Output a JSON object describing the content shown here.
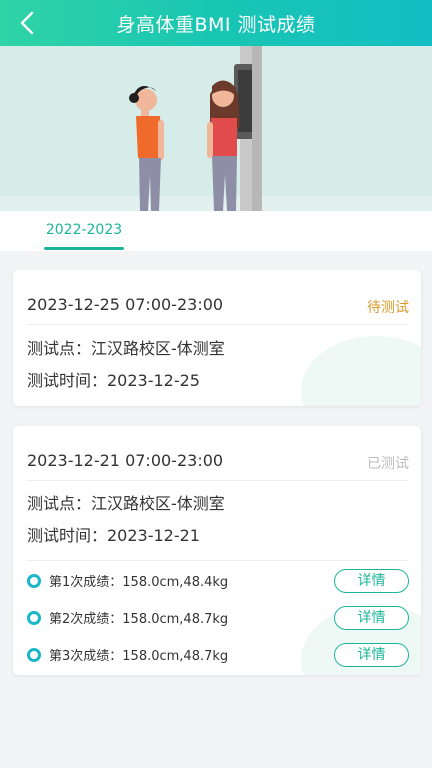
{
  "header": {
    "title": "身高体重BMI 测试成绩"
  },
  "tabs": [
    {
      "label": "2022-2023",
      "active": true
    }
  ],
  "colors": {
    "accent": "#1bb69a",
    "header_start": "#2fd3a6",
    "header_end": "#14bec3",
    "pending": "#d99b2b",
    "done": "#bdbdbd",
    "dot": "#1ab6c9"
  },
  "records": [
    {
      "time_range": "2023-12-25 07:00-23:00",
      "status": "待测试",
      "location": "测试点：江汉路校区-体测室",
      "test_date": "测试时间：2023-12-25"
    },
    {
      "time_range": "2023-12-21 07:00-23:00",
      "status": "已测试",
      "location": "测试点：江汉路校区-体测室",
      "test_date": "测试时间：2023-12-21",
      "results": [
        {
          "text": "第1次成绩：158.0cm,48.4kg",
          "button": "详情"
        },
        {
          "text": "第2次成绩：158.0cm,48.7kg",
          "button": "详情"
        },
        {
          "text": "第3次成绩：158.0cm,48.7kg",
          "button": "详情"
        }
      ]
    }
  ]
}
